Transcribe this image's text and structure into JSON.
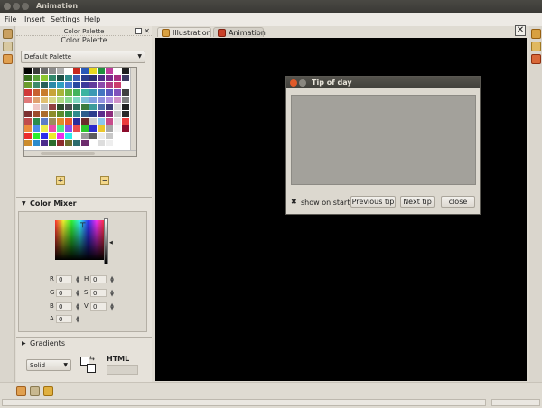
{
  "window": {
    "title": "Animation"
  },
  "menu": [
    "File",
    "Insert",
    "Settings",
    "Help"
  ],
  "tabs": [
    {
      "label": "Illustration",
      "active": true
    },
    {
      "label": "Animation",
      "active": false
    }
  ],
  "color_palette": {
    "header_small": "Color Palette",
    "header": "Color Palette",
    "palette_select": "Default Palette",
    "add_label": "+",
    "remove_label": "−",
    "swatches": [
      [
        "#000000",
        "#3a3a3a",
        "#6a6a6a",
        "#8c8c8c",
        "#b0b0b0",
        "#ffffff",
        "#c8281e",
        "#2858b8",
        "#e8d820",
        "#209040",
        "#c03c9c",
        "#ffffff",
        "#202020"
      ],
      [
        "#3a6e1e",
        "#58a038",
        "#8cc830",
        "#30886c",
        "#1e5046",
        "#2e8c8c",
        "#3a5cb4",
        "#283c8c",
        "#2a2e70",
        "#4c2c88",
        "#7a2a8c",
        "#a82c80",
        "#3e3a62"
      ],
      [
        "#6c9c2c",
        "#3e8c6c",
        "#28605a",
        "#2c8aa8",
        "#30a0c0",
        "#4a7cd0",
        "#2a4aa0",
        "#3c3c9c",
        "#623c9c",
        "#8c4cac",
        "#b03c88",
        "#cc3c6c",
        "#ffffff"
      ],
      [
        "#d03838",
        "#c86030",
        "#c87c2c",
        "#c8a438",
        "#a8b438",
        "#6cb444",
        "#44b45c",
        "#3cb4a0",
        "#3c98b4",
        "#4474c0",
        "#5a58c0",
        "#8050bc",
        "#404040"
      ],
      [
        "#e07878",
        "#e0a070",
        "#e0c070",
        "#d8d888",
        "#b0d880",
        "#88d890",
        "#80d8c0",
        "#80c0d8",
        "#80a0e0",
        "#9090e0",
        "#b090e0",
        "#d090c8",
        "#808080"
      ],
      [
        "#ffffff",
        "#f0c8c8",
        "#c0c0c0",
        "#904040",
        "#2c4c2c",
        "#4a4a4a",
        "#2c6c58",
        "#3c7c3c",
        "#3c9c9c",
        "#4c6cac",
        "#3c3c7c",
        "#dcdcdc",
        "#202020"
      ],
      [
        "#7c3030",
        "#9c4c2c",
        "#ac6c2c",
        "#8c8c2c",
        "#5c8c2c",
        "#2c8c4c",
        "#2c8c8c",
        "#2c5c8c",
        "#2c3c8c",
        "#5c2c8c",
        "#8c2c7c",
        "#c8c8c8",
        "#2a2a2a"
      ],
      [
        "#c04c4c",
        "#2c8c4c",
        "#5c7cc8",
        "#9c8c5c",
        "#e08c2c",
        "#ec5a2c",
        "#2c2c9c",
        "#6c2c2c",
        "#d0d0d0",
        "#8cc8ec",
        "#c84c8c",
        "#e8e8e8",
        "#ec3c3c"
      ],
      [
        "#ec8c3c",
        "#4c8cec",
        "#ecec4c",
        "#ec4ca8",
        "#4cec8c",
        "#8c4cec",
        "#ec4c4c",
        "#2cc82c",
        "#2c2ccc",
        "#ecc82c",
        "#a8a8a8",
        "#f4f4f4",
        "#8c0c2c"
      ],
      [
        "#ec2c2c",
        "#2cec2c",
        "#2c2cec",
        "#ecec2c",
        "#ec2cec",
        "#2cecec",
        "#ffffff",
        "#9c9c9c",
        "#5c5c5c",
        "#ececec",
        "#c8c8c8",
        "#ffffff",
        "#ffffff"
      ],
      [
        "#cc8c2c",
        "#2c8ccc",
        "#4c2c8c",
        "#2c6c2c",
        "#8c2c2c",
        "#6c6c2c",
        "#2c6c6c",
        "#6c2c6c",
        "#ffffff",
        "#dddddd",
        "#eeeeee",
        "#ffffff",
        "#ffffff"
      ]
    ]
  },
  "color_mixer": {
    "title": "Color Mixer",
    "fields": [
      {
        "label": "R",
        "value": "0"
      },
      {
        "label": "H",
        "value": "0"
      },
      {
        "label": "G",
        "value": "0"
      },
      {
        "label": "S",
        "value": "0"
      },
      {
        "label": "B",
        "value": "0"
      },
      {
        "label": "V",
        "value": "0"
      },
      {
        "label": "A",
        "value": "0"
      }
    ]
  },
  "gradients": {
    "title": "Gradients",
    "type_select": "Solid",
    "html_label": "HTML"
  },
  "tip_dialog": {
    "title": "Tip of day",
    "show_on_start_label": "show on start",
    "show_on_start_checked": true,
    "previous_label": "Previous tip",
    "next_label": "Next tip",
    "close_label": "close"
  },
  "colors": {
    "canvas": "#000000",
    "panel": "#e6e2da",
    "titlebar": "#3f3e3a",
    "close_button": "#e05a2a"
  }
}
